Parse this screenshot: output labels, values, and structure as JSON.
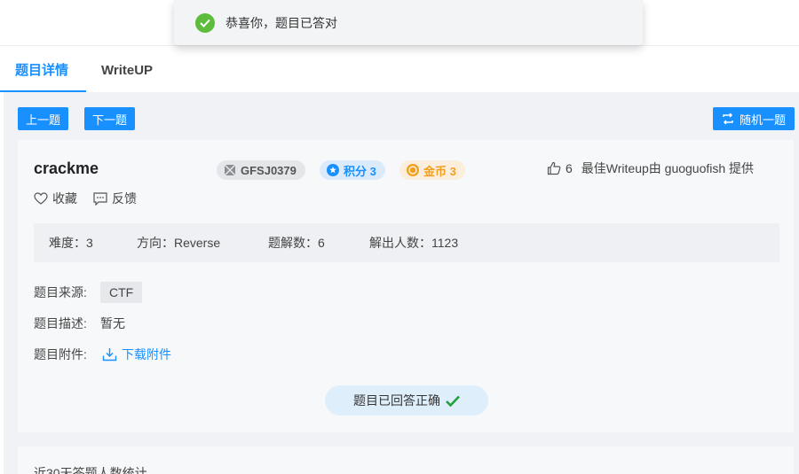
{
  "toast": {
    "message": "恭喜你，题目已答对"
  },
  "tabs": [
    {
      "label": "题目详情"
    },
    {
      "label": "WriteUP"
    }
  ],
  "nav": {
    "prev": "上一题",
    "next": "下一题",
    "random": "随机一题"
  },
  "challenge": {
    "title": "crackme",
    "id": "GFSJ0379",
    "score": "积分 3",
    "coins": "金币 3",
    "likes": "6",
    "best_writeup": "最佳Writeup由 guoguofish 提供",
    "favorite": "收藏",
    "feedback": "反馈"
  },
  "stats": {
    "difficulty": "难度：3",
    "direction": "方向：Reverse",
    "solutions": "题解数：6",
    "solvers": "解出人数：1123"
  },
  "details": {
    "source_label": "题目来源:",
    "source": "CTF",
    "desc_label": "题目描述:",
    "desc": "暂无",
    "attach_label": "题目附件:",
    "download": "下载附件"
  },
  "answered": "题目已回答正确",
  "recent": "近30天答题人数统计",
  "colors": {
    "primary": "#1890ff",
    "success": "#5ebc3c",
    "coin": "#f0a020"
  }
}
